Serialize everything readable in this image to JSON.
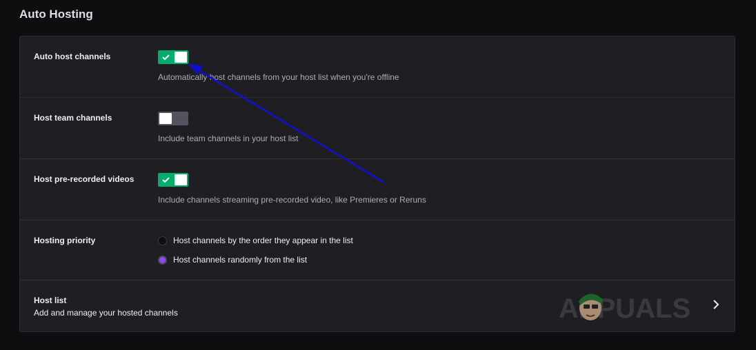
{
  "section": {
    "title": "Auto Hosting"
  },
  "settings": [
    {
      "label": "Auto host channels",
      "enabled": true,
      "description": "Automatically host channels from your host list when you're offline"
    },
    {
      "label": "Host team channels",
      "enabled": false,
      "description": "Include team channels in your host list"
    },
    {
      "label": "Host pre-recorded videos",
      "enabled": true,
      "description": "Include channels streaming pre-recorded video, like Premieres or Reruns"
    }
  ],
  "hosting_priority": {
    "label": "Hosting priority",
    "options": [
      {
        "label": "Host channels by the order they appear in the list",
        "selected": false
      },
      {
        "label": "Host channels randomly from the list",
        "selected": true
      }
    ]
  },
  "host_list": {
    "title": "Host list",
    "subtitle": "Add and manage your hosted channels"
  },
  "watermark": {
    "text": "APPUALS"
  },
  "colors": {
    "toggle_on": "#00ad6c",
    "toggle_off": "#53535f",
    "radio_selected": "#9147ff",
    "annotation_arrow": "#1010d0"
  }
}
